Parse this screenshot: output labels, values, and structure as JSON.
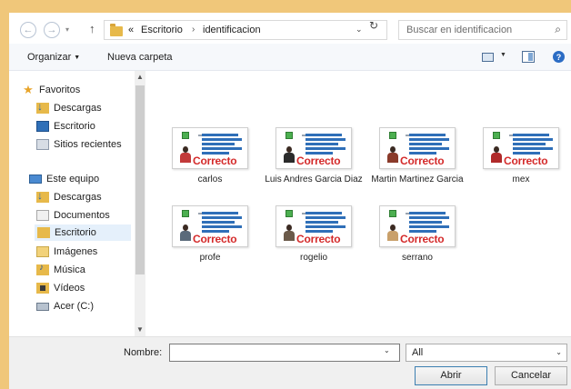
{
  "address": {
    "path_overflow": "«",
    "segments": [
      "Escritorio",
      "identificacion"
    ],
    "search_placeholder": "Buscar en identificacion"
  },
  "toolbar": {
    "organize_label": "Organizar",
    "new_folder_label": "Nueva carpeta"
  },
  "nav": {
    "items": [
      {
        "label": "Favoritos",
        "icon": "star-icon"
      },
      {
        "label": "Descargas",
        "icon": "downloads-icon"
      },
      {
        "label": "Escritorio",
        "icon": "desktop-icon"
      },
      {
        "label": "Sitios recientes",
        "icon": "recent-places-icon"
      },
      {
        "label": "Este equipo",
        "icon": "computer-icon"
      },
      {
        "label": "Descargas",
        "icon": "downloads-icon"
      },
      {
        "label": "Documentos",
        "icon": "documents-icon"
      },
      {
        "label": "Escritorio",
        "icon": "desktop-folder-icon",
        "selected": true
      },
      {
        "label": "Imágenes",
        "icon": "pictures-icon"
      },
      {
        "label": "Música",
        "icon": "music-icon"
      },
      {
        "label": "Vídeos",
        "icon": "videos-icon"
      },
      {
        "label": "Acer (C:)",
        "icon": "drive-icon"
      }
    ]
  },
  "files": {
    "badge_text": "Correcto",
    "items": [
      {
        "name": "carlos",
        "photo_color": "#c23a3a"
      },
      {
        "name": "Luis Andres Garcia Diaz",
        "photo_color": "#2b2b2b"
      },
      {
        "name": "Martin Martinez Garcia",
        "photo_color": "#8a3a2a"
      },
      {
        "name": "mex",
        "photo_color": "#b02a2a"
      },
      {
        "name": "profe",
        "photo_color": "#5a6a7a"
      },
      {
        "name": "rogelio",
        "photo_color": "#6b5a4a"
      },
      {
        "name": "serrano",
        "photo_color": "#c9a06a"
      }
    ]
  },
  "footer": {
    "name_label": "Nombre:",
    "name_value": "",
    "filter_value": "All",
    "open_label": "Abrir",
    "cancel_label": "Cancelar"
  }
}
